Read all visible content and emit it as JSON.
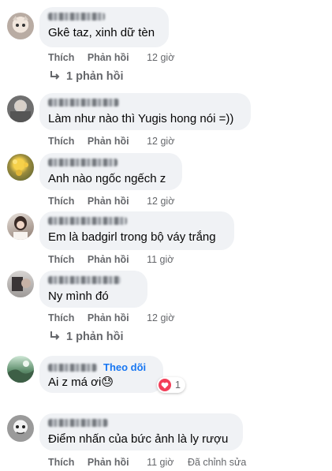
{
  "comments": [
    {
      "text": "Gkê taz, xinh dữ tèn",
      "like": "Thích",
      "reply": "Phản hồi",
      "time": "12 giờ",
      "replies": "1 phản hồi"
    },
    {
      "text": "Làm như nào thì Yugis hong nói =))",
      "like": "Thích",
      "reply": "Phản hồi",
      "time": "12 giờ"
    },
    {
      "text": "Anh nào ngốc ngếch z",
      "like": "Thích",
      "reply": "Phản hồi",
      "time": "12 giờ"
    },
    {
      "text": "Em là badgirl trong bộ váy trắng",
      "like": "Thích",
      "reply": "Phản hồi",
      "time": "11 giờ"
    },
    {
      "text": "Ny mình đó",
      "like": "Thích",
      "reply": "Phản hồi",
      "time": "12 giờ",
      "replies": "1 phản hồi"
    },
    {
      "text": "Ai z má ơi😓",
      "follow": "Theo dõi",
      "reaction_count": "1"
    },
    {
      "text": "Điểm nhấn của bức ảnh là ly rượu",
      "like": "Thích",
      "reply": "Phản hồi",
      "time": "11 giờ",
      "edited": "Đã chỉnh sửa"
    }
  ],
  "icons": {
    "reply_arrow": "reply-arrow-icon",
    "reaction": "heart-icon"
  },
  "colors": {
    "bubble": "#f0f2f5",
    "meta": "#65676b",
    "link": "#1877f2",
    "heart": "#f33e58"
  }
}
